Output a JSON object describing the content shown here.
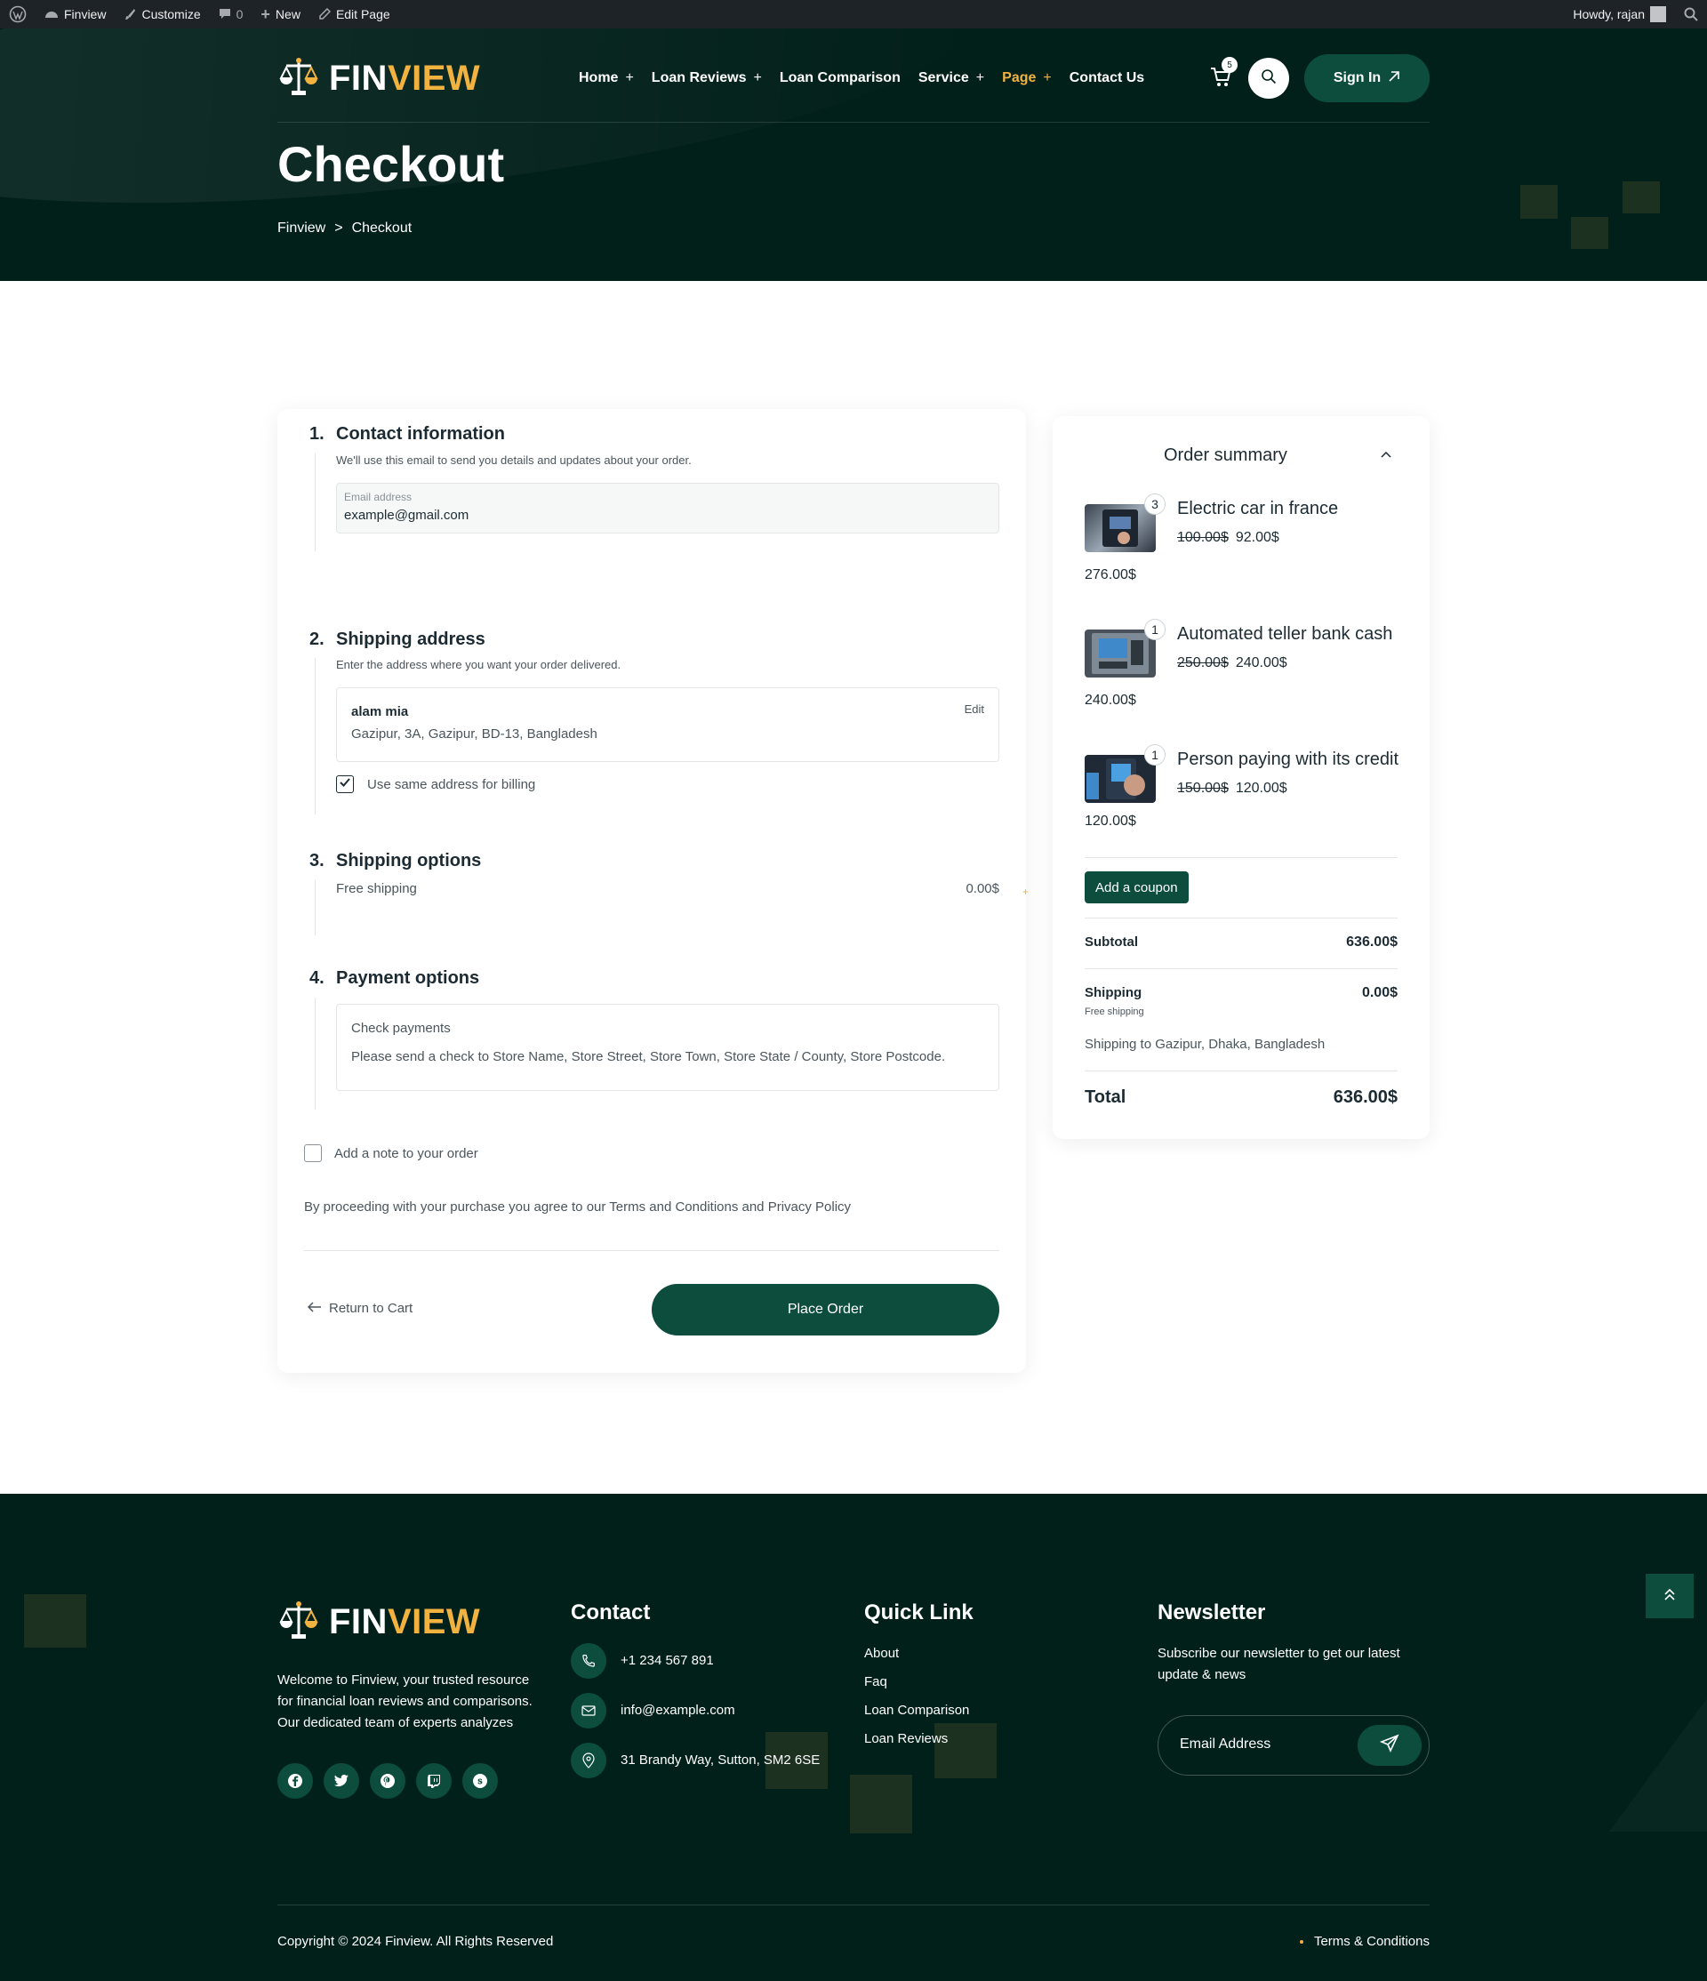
{
  "admin_bar": {
    "site": "Finview",
    "customize": "Customize",
    "comments": "0",
    "new": "New",
    "edit_page": "Edit Page",
    "howdy": "Howdy, rajan"
  },
  "brand": {
    "logo_white": "FIN",
    "logo_yellow": "VIEW",
    "accent": "#f2b23f",
    "dark": "#02201a",
    "primary": "#0c4d3e"
  },
  "nav": {
    "items": [
      {
        "label": "Home",
        "plus": "+"
      },
      {
        "label": "Loan Reviews",
        "plus": "+"
      },
      {
        "label": "Loan Comparison",
        "plus": ""
      },
      {
        "label": "Service",
        "plus": "+"
      },
      {
        "label": "Page",
        "plus": "+"
      },
      {
        "label": "Contact Us",
        "plus": ""
      }
    ],
    "cart_count": "5",
    "sign_in": "Sign In"
  },
  "hero": {
    "title": "Checkout",
    "breadcrumb": [
      "Finview",
      ">",
      "Checkout"
    ]
  },
  "checkout": {
    "contact": {
      "number": "1.",
      "title": "Contact information",
      "desc": "We'll use this email to send you details and updates about your order.",
      "email_label": "Email address",
      "email_value": "example@gmail.com"
    },
    "shipping_address": {
      "number": "2.",
      "title": "Shipping address",
      "desc": "Enter the address where you want your order delivered.",
      "name": "alam mia",
      "address": "Gazipur, 3A, Gazipur, BD-13, Bangladesh",
      "edit": "Edit",
      "same_billing": "Use same address for billing"
    },
    "shipping_options": {
      "number": "3.",
      "title": "Shipping options",
      "option": "Free shipping",
      "price": "0.00$"
    },
    "payment": {
      "number": "4.",
      "title": "Payment options",
      "method": "Check payments",
      "instructions": "Please send a check to Store Name, Store Street, Store Town, Store State / County, Store Postcode."
    },
    "note": "Add a note to your order",
    "terms": "By proceeding with your purchase you agree to our Terms and Conditions and Privacy Policy",
    "return": "Return to Cart",
    "place_order": "Place Order"
  },
  "summary": {
    "title": "Order summary",
    "items": [
      {
        "qty": "3",
        "name": "Electric car in france",
        "old": "100.00$",
        "price": "92.00$",
        "total": "276.00$"
      },
      {
        "qty": "1",
        "name": "Automated teller bank cash",
        "old": "250.00$",
        "price": "240.00$",
        "total": "240.00$"
      },
      {
        "qty": "1",
        "name": "Person paying with its credit",
        "old": "150.00$",
        "price": "120.00$",
        "total": "120.00$"
      }
    ],
    "coupon": "Add a coupon",
    "subtotal_label": "Subtotal",
    "subtotal": "636.00$",
    "shipping_label": "Shipping",
    "shipping": "0.00$",
    "shipping_sub": "Free shipping",
    "shipping_to": "Shipping to Gazipur, Dhaka, Bangladesh",
    "total_label": "Total",
    "total": "636.00$"
  },
  "footer": {
    "about": "Welcome to Finview, your trusted resource for financial loan reviews and comparisons. Our dedicated team of experts analyzes",
    "about_lines": [
      "Welcome to Finview, your trusted resource",
      "for financial loan reviews and comparisons.",
      "Our dedicated team of experts analyzes"
    ],
    "contact_title": "Contact",
    "phone": "+1 234 567 891",
    "email": "info@example.com",
    "address": "31 Brandy Way, Sutton, SM2 6SE",
    "quick_title": "Quick Link",
    "links": [
      "About",
      "Faq",
      "Loan Comparison",
      "Loan Reviews"
    ],
    "newsletter_title": "Newsletter",
    "newsletter_lines": [
      "Subscribe our newsletter to get our latest",
      "update & news"
    ],
    "email_placeholder": "Email Address",
    "copyright": "Copyright © 2024 Finview. All Rights Reserved",
    "terms": "Terms & Conditions"
  }
}
